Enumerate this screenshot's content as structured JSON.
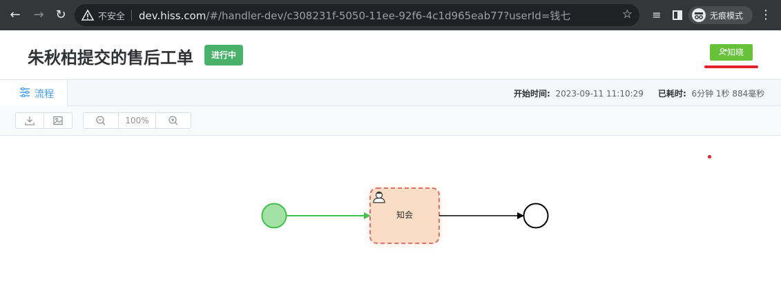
{
  "browser": {
    "security_label": "不安全",
    "url_host": "dev.hiss.com",
    "url_path": "/#/handler-dev/c308231f-5050-11ee-92f6-4c1d965eab77?userId=钱七",
    "incognito_label": "无痕模式"
  },
  "header": {
    "title": "朱秋柏提交的售后工单",
    "status": "进行中",
    "status_color": "#48b26a",
    "ack_button": "知晓",
    "ack_color": "#67c23a"
  },
  "tabs": {
    "active_label": "流程"
  },
  "meta": {
    "start_label": "开始时间:",
    "start_value": "2023-09-11 11:10:29",
    "elapsed_label": "已耗时:",
    "elapsed_value": "6分钟 1秒 884毫秒"
  },
  "toolbar": {
    "zoom": "100%"
  },
  "flow": {
    "task_label": "知会",
    "start_fill": "#a3e2a4",
    "start_stroke": "#3fc04a",
    "task_fill": "#fbdcc4",
    "task_stroke": "#e0706b"
  }
}
